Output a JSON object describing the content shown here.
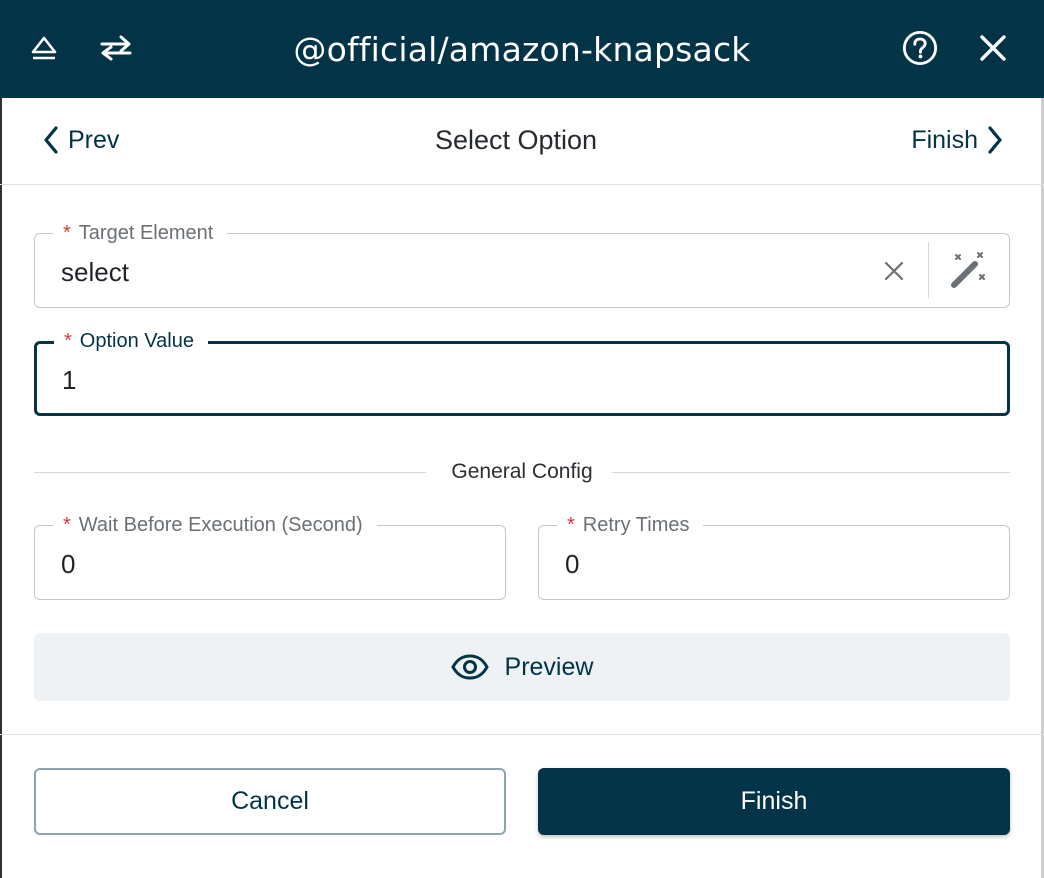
{
  "header": {
    "title": "@official/amazon-knapsack",
    "icons": [
      "collapse-icon",
      "swap-icon",
      "help-icon",
      "close-icon"
    ],
    "background": "#023347"
  },
  "nav": {
    "prev_label": "Prev",
    "title": "Select Option",
    "finish_label": "Finish"
  },
  "form": {
    "target_element": {
      "label": "Target Element",
      "value": "select"
    },
    "option_value": {
      "label": "Option Value",
      "value": "1"
    },
    "section_label": "General Config",
    "wait_before": {
      "label": "Wait Before Execution (Second)",
      "value": "0"
    },
    "retry_times": {
      "label": "Retry Times",
      "value": "0"
    },
    "required_mark": "*"
  },
  "actions": {
    "preview_label": "Preview",
    "cancel_label": "Cancel",
    "finish_label": "Finish"
  },
  "colors": {
    "accent": "#023347",
    "required": "#d9363e",
    "preview_bg": "#eef2f5"
  }
}
